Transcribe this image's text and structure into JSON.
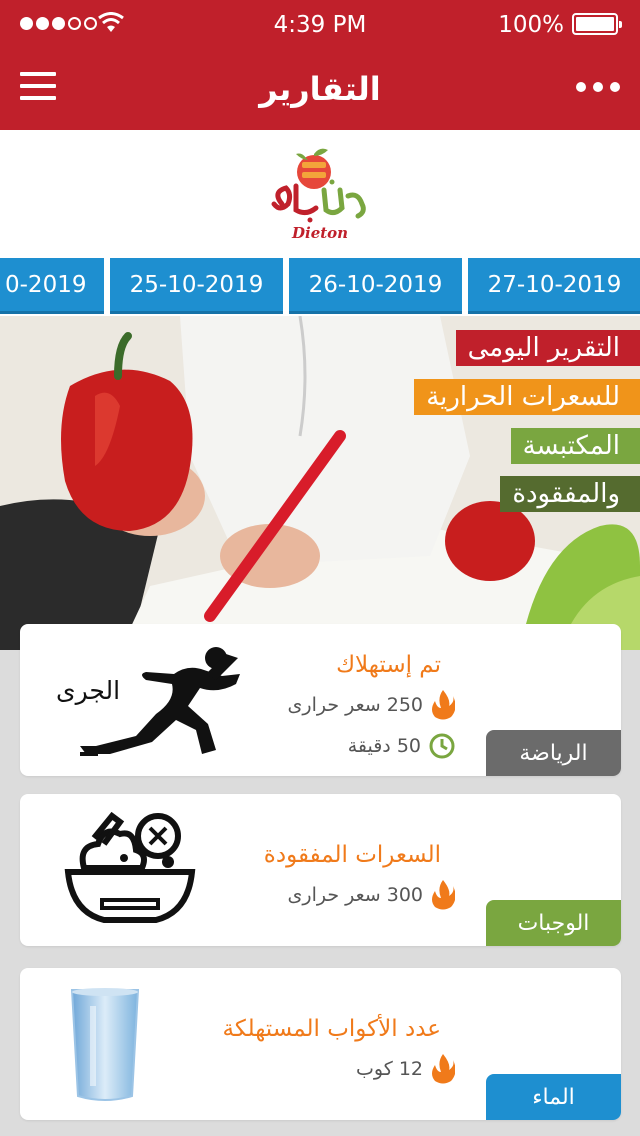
{
  "status_bar": {
    "time": "4:39 PM",
    "battery_percent": "100%",
    "signal_bars_filled": 3,
    "signal_bars_total": 5
  },
  "header": {
    "title": "التقارير",
    "menu_icon": "hamburger-icon",
    "more_icon": "more-dots-icon",
    "background_color": "#c0202b"
  },
  "logo": {
    "arabic_text": "دايتون",
    "latin_text": "Dieton"
  },
  "dates": [
    "27-10-2019",
    "26-10-2019",
    "25-10-2019",
    "0-2019"
  ],
  "hero": {
    "lines": [
      {
        "text": "التقرير اليومى",
        "color": "#c0202b"
      },
      {
        "text": "للسعرات الحرارية",
        "color": "#f0941a"
      },
      {
        "text": "المكتبسة",
        "color": "#7aa640"
      },
      {
        "text": "والمفقودة",
        "color": "#556b2f"
      }
    ]
  },
  "cards": [
    {
      "icon": "runner-icon",
      "icon_label": "الجرى",
      "title": "تم إستهلاك",
      "rows": [
        {
          "icon": "flame-icon",
          "text": "250 سعر حرارى"
        },
        {
          "icon": "clock-icon",
          "text": "50 دقيقة"
        }
      ],
      "tag": "الرياضة",
      "tag_color": "#6b6b6b"
    },
    {
      "icon": "salad-bowl-icon",
      "title": "السعرات المفقودة",
      "rows": [
        {
          "icon": "flame-icon",
          "text": "300 سعر حرارى"
        }
      ],
      "tag": "الوجبات",
      "tag_color": "#7aa640"
    },
    {
      "icon": "water-glass-icon",
      "title": "عدد الأكواب المستهلكة",
      "rows": [
        {
          "icon": "flame-icon",
          "text": "12 كوب"
        }
      ],
      "tag": "الماء",
      "tag_color": "#1e8fd0"
    }
  ]
}
